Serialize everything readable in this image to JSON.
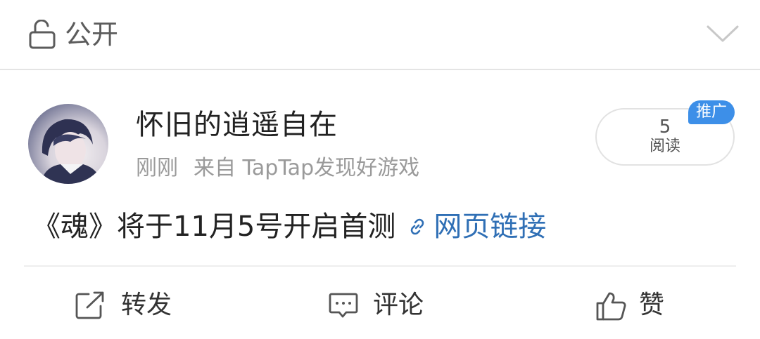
{
  "privacy": {
    "label": "公开",
    "icon": "lock-open-icon",
    "toggle_icon": "chevron-down-icon"
  },
  "post": {
    "author": "怀旧的逍遥自在",
    "time": "刚刚",
    "source": "来自 TapTap发现好游戏",
    "read_count": "5",
    "read_label": "阅读",
    "promo_badge": "推广",
    "content_text": "《魂》将于11月5号开启首测",
    "link_text": "网页链接"
  },
  "actions": {
    "repost": "转发",
    "comment": "评论",
    "like": "赞"
  },
  "colors": {
    "link": "#2f6fb5",
    "badge": "#3d8fe8",
    "muted_text": "#9a9a9a"
  }
}
